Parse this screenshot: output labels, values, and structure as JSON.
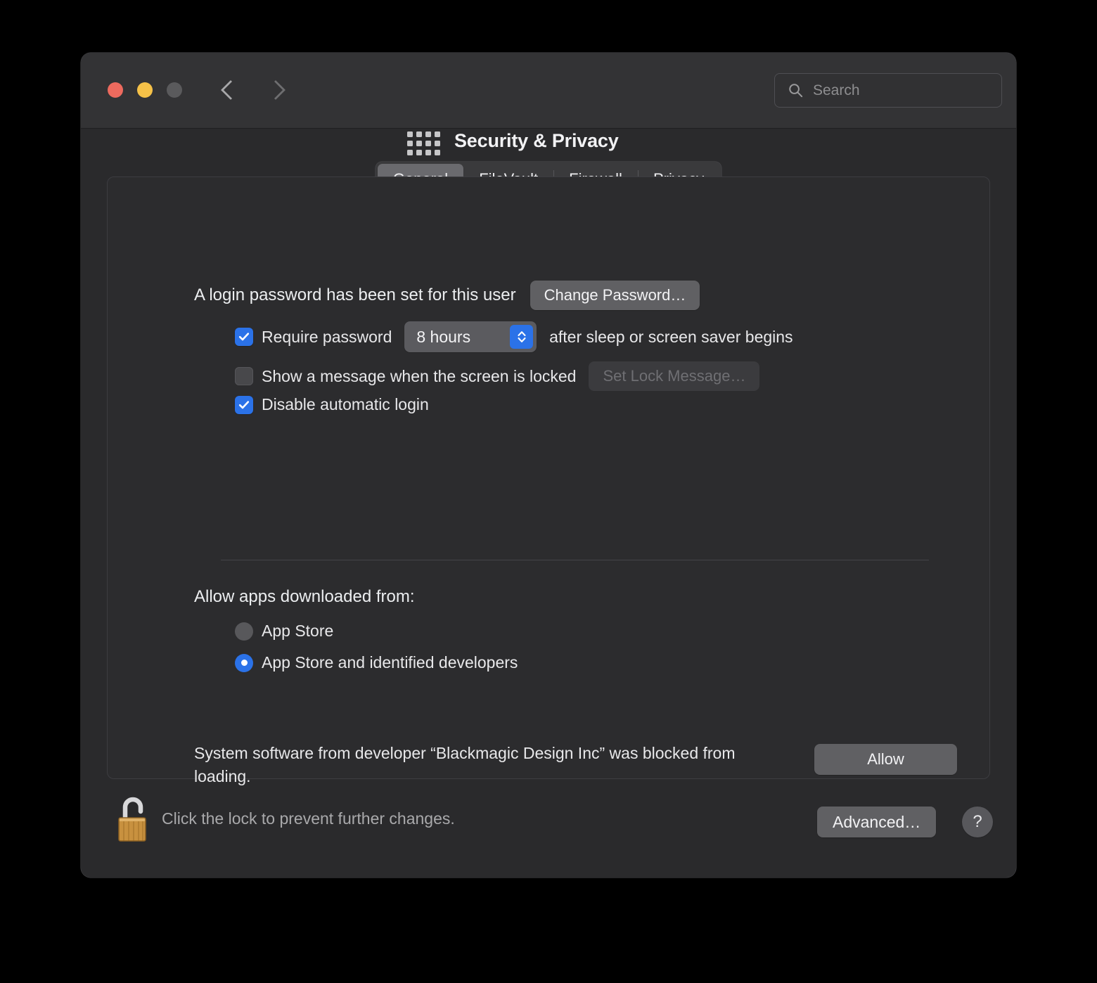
{
  "window": {
    "title": "Security & Privacy",
    "traffic_lights": {
      "close_label": "close",
      "minimize_label": "minimize",
      "zoom_label": "zoom"
    },
    "nav": {
      "back_label": "Back",
      "forward_label": "Forward",
      "show_all_label": "Show All"
    },
    "colors": {
      "close": "#ED6A5E",
      "minimize": "#F5C148",
      "zoom_disabled": "#5A5A5C",
      "accent_blue": "#2B72E8",
      "window_bg": "#2A2A2C",
      "titlebar_bg": "#333335",
      "panel_bg": "#2C2C2E"
    }
  },
  "search": {
    "placeholder": "Search",
    "value": "",
    "icon": "search-icon"
  },
  "tabs": [
    {
      "label": "General",
      "active": true
    },
    {
      "label": "FileVault",
      "active": false
    },
    {
      "label": "Firewall",
      "active": false
    },
    {
      "label": "Privacy",
      "active": false
    }
  ],
  "general": {
    "password_status": "A login password has been set for this user",
    "change_password_button": "Change Password…",
    "require_password": {
      "label": "Require password",
      "checked": true,
      "interval_value": "8 hours",
      "suffix": "after sleep or screen saver begins"
    },
    "show_message": {
      "label": "Show a message when the screen is locked",
      "checked": false,
      "button": "Set Lock Message…",
      "button_disabled": true
    },
    "disable_auto_login": {
      "label": "Disable automatic login",
      "checked": true
    },
    "allow_apps": {
      "heading": "Allow apps downloaded from:",
      "options": [
        {
          "label": "App Store",
          "selected": false
        },
        {
          "label": "App Store and identified developers",
          "selected": true
        }
      ]
    },
    "blocked_notice": {
      "text": "System software from developer “Blackmagic Design Inc” was blocked from loading.",
      "allow_button": "Allow"
    }
  },
  "footer": {
    "lock_icon": "unlocked-padlock-icon",
    "lock_text": "Click the lock to prevent further changes.",
    "advanced_button": "Advanced…",
    "help_button": "?"
  }
}
